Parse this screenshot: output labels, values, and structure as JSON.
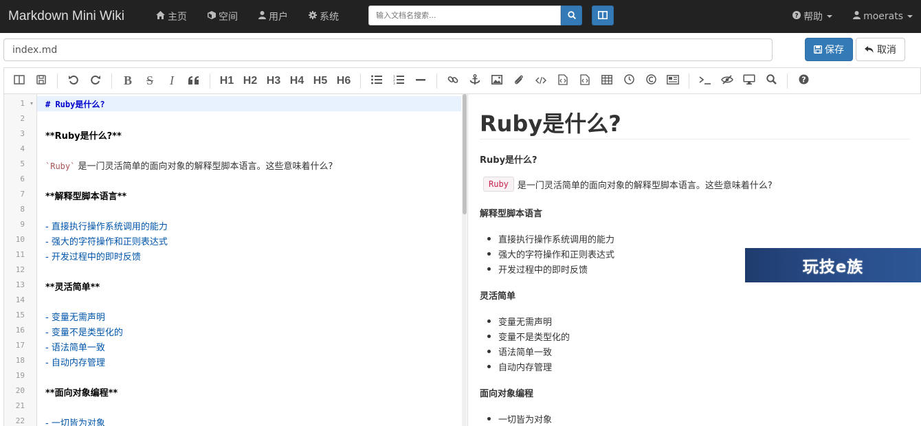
{
  "navbar": {
    "brand": "Markdown Mini Wiki",
    "links": [
      {
        "label": "主页",
        "icon": "home-icon"
      },
      {
        "label": "空间",
        "icon": "cube-icon"
      },
      {
        "label": "用户",
        "icon": "user-icon"
      },
      {
        "label": "系统",
        "icon": "gear-icon"
      }
    ],
    "search_placeholder": "输入文档名搜索...",
    "help_label": "帮助",
    "user_label": "moerats"
  },
  "file": {
    "name": "index.md",
    "save_label": "保存",
    "cancel_label": "取消"
  },
  "toolbar": {
    "headings": [
      "H1",
      "H2",
      "H3",
      "H4",
      "H5",
      "H6"
    ],
    "bold": "B",
    "strike": "S",
    "italic": "I"
  },
  "editor": {
    "line_numbers": [
      "1",
      "2",
      "3",
      "4",
      "5",
      "6",
      "7",
      "8",
      "9",
      "10",
      "11",
      "12",
      "13",
      "14",
      "15",
      "16",
      "17",
      "18",
      "19",
      "20",
      "21",
      "22"
    ],
    "lines": {
      "l1": "# Ruby是什么?",
      "l3": "**Ruby是什么?**",
      "l5_code": "`Ruby`",
      "l5_text": "是一门灵活简单的面向对象的解释型脚本语言。这些意味着什么?",
      "l7": "**解释型脚本语言**",
      "l9": "- 直接执行操作系统调用的能力",
      "l10": "- 强大的字符操作和正则表达式",
      "l11": "- 开发过程中的即时反馈",
      "l13": "**灵活简单**",
      "l15": "- 变量无需声明",
      "l16": "- 变量不是类型化的",
      "l17": "- 语法简单一致",
      "l18": "- 自动内存管理",
      "l20": "**面向对象编程**",
      "l22": "- 一切皆为对象"
    }
  },
  "preview": {
    "h1": "Ruby是什么?",
    "s1": "Ruby是什么?",
    "p1_code": "Ruby",
    "p1_text": "是一门灵活简单的面向对象的解释型脚本语言。这些意味着什么?",
    "s2": "解释型脚本语言",
    "list1": [
      "直接执行操作系统调用的能力",
      "强大的字符操作和正则表达式",
      "开发过程中的即时反馈"
    ],
    "s3": "灵活简单",
    "list2": [
      "变量无需声明",
      "变量不是类型化的",
      "语法简单一致",
      "自动内存管理"
    ],
    "s4": "面向对象编程",
    "list3": [
      "一切皆为对象"
    ]
  },
  "banner": {
    "text": "玩技e族"
  },
  "colors": {
    "navbar_bg": "#222222",
    "primary": "#337ab7",
    "heading_md": "#0000cc",
    "list_md": "#0055aa",
    "inline_code": "#c7254e"
  }
}
